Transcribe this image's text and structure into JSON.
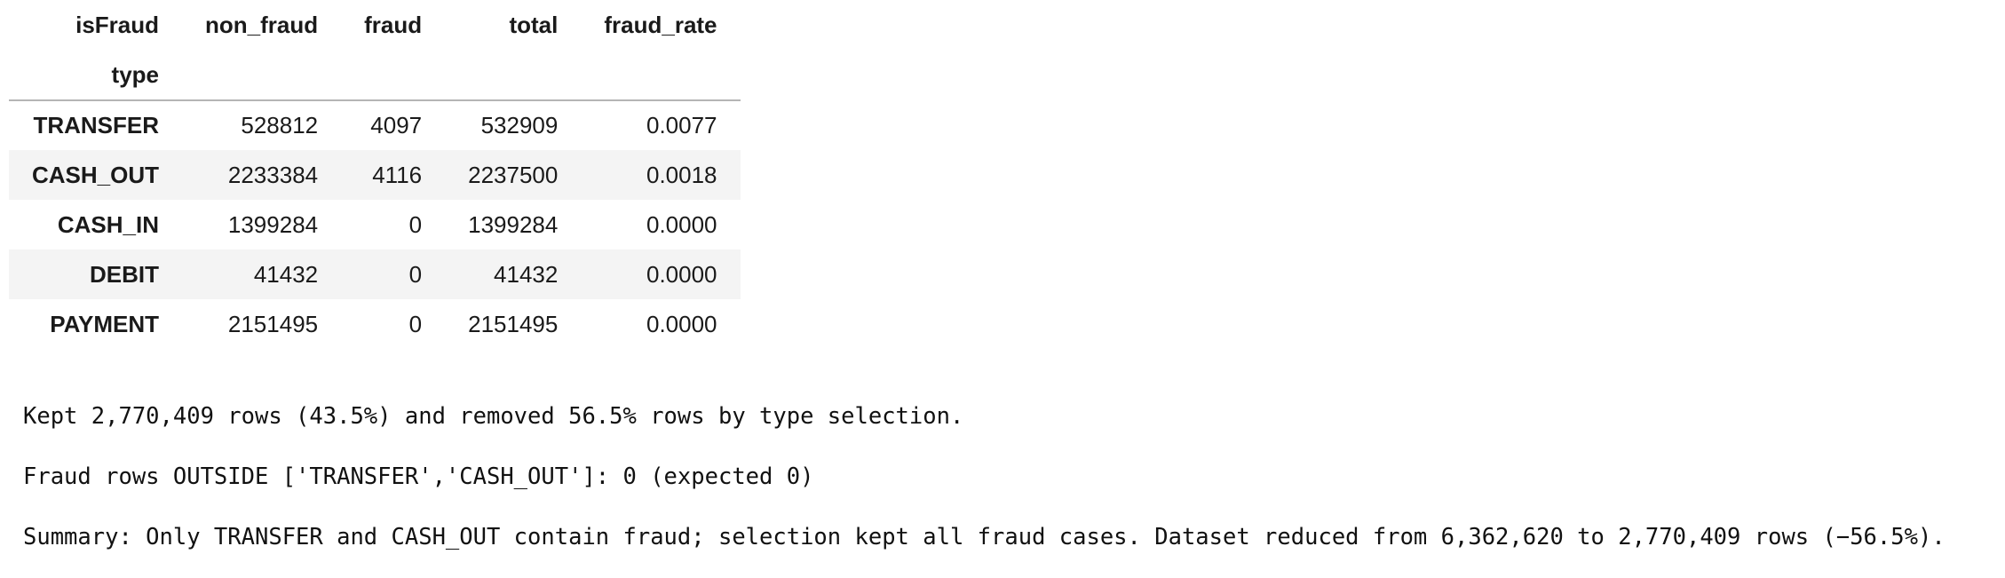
{
  "table": {
    "columns_name": "isFraud",
    "index_name": "type",
    "columns": [
      "non_fraud",
      "fraud",
      "total",
      "fraud_rate"
    ],
    "rows": [
      {
        "type": "TRANSFER",
        "cells": [
          "528812",
          "4097",
          "532909",
          "0.0077"
        ]
      },
      {
        "type": "CASH_OUT",
        "cells": [
          "2233384",
          "4116",
          "2237500",
          "0.0018"
        ]
      },
      {
        "type": "CASH_IN",
        "cells": [
          "1399284",
          "0",
          "1399284",
          "0.0000"
        ]
      },
      {
        "type": "DEBIT",
        "cells": [
          "41432",
          "0",
          "41432",
          "0.0000"
        ]
      },
      {
        "type": "PAYMENT",
        "cells": [
          "2151495",
          "0",
          "2151495",
          "0.0000"
        ]
      }
    ]
  },
  "output": {
    "lines": [
      "Kept 2,770,409 rows (43.5%) and removed 56.5% rows by type selection.",
      "Fraud rows OUTSIDE ['TRANSFER','CASH_OUT']: 0 (expected 0)",
      "Summary: Only TRANSFER and CASH_OUT contain fraud; selection kept all fraud cases. Dataset reduced from 6,362,620 to 2,770,409 rows (−56.5%)."
    ]
  }
}
